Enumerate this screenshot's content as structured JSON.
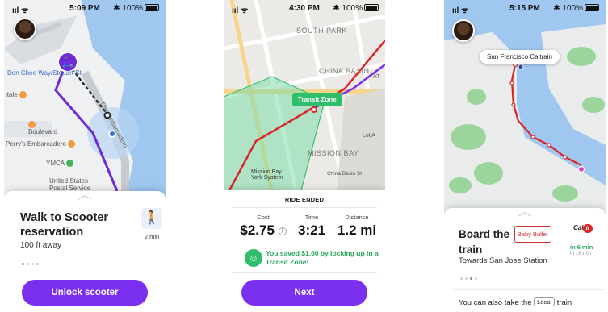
{
  "screens": [
    {
      "status": {
        "signal": "ııl ᯤ",
        "time": "5:09 PM",
        "battery": "✱ 100%"
      },
      "map_labels": {
        "place1": "Don Chee Way/Steuart St",
        "place2": "itale",
        "place3": "Boulevard",
        "place4": "Perry's Embarcadero",
        "place5": "YMCA",
        "place6": "United States",
        "place7": "Postal Service",
        "street": "The Embarcadero"
      },
      "card": {
        "title": "Walk to Scooter reservation",
        "subtitle": "100 ft away",
        "walk_time": "2 min",
        "button": "Unlock scooter"
      }
    },
    {
      "status": {
        "signal": "ııl ᯤ",
        "time": "4:30 PM",
        "battery": "✱ 100%"
      },
      "map_labels": {
        "south_park": "SOUTH PARK",
        "china_basin": "CHINA BASIN",
        "mission_bay": "MISSION BAY",
        "mission_bay_ferry": "Mission Bay",
        "york_system": "York System",
        "at": "AT",
        "lot_a": "Lot A",
        "china_basin_st": "China Basin St",
        "transit_zone": "Transit Zone"
      },
      "card": {
        "heading": "RIDE ENDED",
        "cost_label": "Cost",
        "cost_value": "$2.75",
        "time_label": "Time",
        "time_value": "3:21",
        "distance_label": "Distance",
        "distance_value": "1.2 mi",
        "saved_message": "You saved $1.00 by locking up in a Transit Zone!",
        "button": "Next"
      }
    },
    {
      "status": {
        "signal": "ııl ᯤ",
        "time": "5:15 PM",
        "battery": "✱ 100%"
      },
      "map_labels": {
        "station_pill": "San Francisco Caltrain"
      },
      "card": {
        "title_prefix": "Board the",
        "badge": "Baby Bullet",
        "title_suffix": "train",
        "subtitle": "Towards San Jose Station",
        "brand": "Cal",
        "eta_primary": "in 6 min",
        "eta_secondary": "in 18 min",
        "also_prefix": "You can also take the",
        "local_badge": "Local",
        "also_suffix": "train"
      }
    }
  ],
  "colors": {
    "accent_purple": "#7b2ff0",
    "transit_green": "#2fbf6a",
    "route_red": "#d8262b",
    "water_blue": "#9fc7f0"
  }
}
